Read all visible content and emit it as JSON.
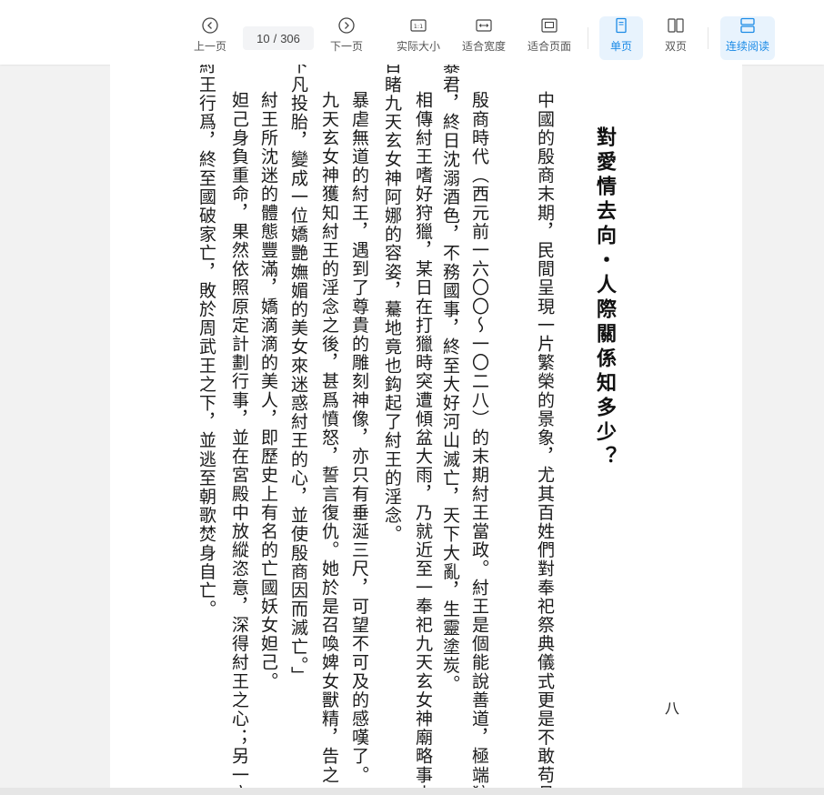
{
  "toolbar": {
    "prev_label": "上一页",
    "page_current": "10",
    "page_sep": "/",
    "page_total": "306",
    "next_label": "下一页",
    "actual_size_label": "实际大小",
    "fit_width_label": "适合宽度",
    "fit_page_label": "适合页面",
    "single_label": "单页",
    "double_label": "双页",
    "continuous_label": "连续阅读",
    "icon_1to1_text": "1:1",
    "accent_color": "#1c8be6"
  },
  "page": {
    "title": "對愛情去向・人際關係知多少？",
    "page_number": "八",
    "columns": [
      "中國的殷商末期，民間呈現一片繁榮的景象，尤其百姓們對奉祀祭典儀式更是不敢苟且敷",
      "殷商時代（西元前一六〇〇～一〇二八）的末期紂王當政。紂王是個能說善道，極端狡猾",
      "暴君，終日沈溺酒色，不務國事，終至大好河山滅亡，天下大亂，生靈塗炭。",
      "相傳紂王嗜好狩獵，某日在打獵時突遭傾盆大雨，乃就近至一奉祀九天玄女神廟略事小憩",
      "目睹九天玄女神阿娜的容姿，驀地竟也鈎起了紂王的淫念。",
      "暴虐無道的紂王，遇到了尊貴的雕刻神像，亦只有垂涎三尺，可望不可及的感嘆了。",
      "九天玄女神獲知紂王的淫念之後，甚爲憤怒，誓言復仇。她於是召喚婢女獸精，告之「妳",
      "下凡投胎，變成一位嬌艷嫵媚的美女來迷惑紂王的心，並使殷商因而滅亡。」",
      "紂王所沈迷的體態豐滿，嬌滴滴的美人，即歷史上有名的亡國妖女妲己。",
      "妲己身負重命，果然依照原定計劃行事，並在宮殿中放縱恣意，深得紂王之心；另一方面",
      "紂王行爲，終至國破家亡，敗於周武王之下，並逃至朝歌焚身自亡。"
    ]
  }
}
